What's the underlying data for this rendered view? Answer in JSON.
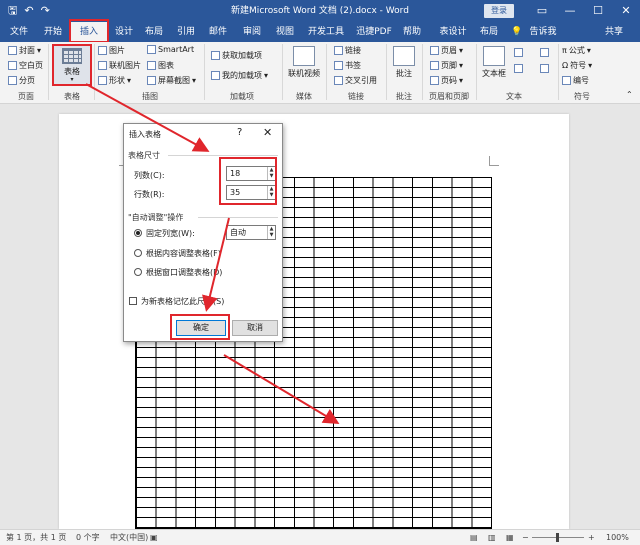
{
  "titlebar": {
    "title": "新建Microsoft Word 文档 (2).docx  -  Word",
    "login_label": "登录",
    "qat": {
      "save": "🖫",
      "undo": "↶",
      "redo": "↷"
    },
    "win": {
      "restore": "▭",
      "minimize": "—",
      "maximize": "☐",
      "close": "✕"
    }
  },
  "tabs": {
    "items": [
      {
        "label": "文件"
      },
      {
        "label": "开始"
      },
      {
        "label": "插入"
      },
      {
        "label": "设计"
      },
      {
        "label": "布局"
      },
      {
        "label": "引用"
      },
      {
        "label": "邮件"
      },
      {
        "label": "审阅"
      },
      {
        "label": "视图"
      },
      {
        "label": "开发工具"
      },
      {
        "label": "迅捷PDF"
      },
      {
        "label": "帮助"
      },
      {
        "label": "表设计"
      },
      {
        "label": "布局"
      }
    ],
    "tell_me": "告诉我",
    "share": "共享"
  },
  "ribbon": {
    "pages": {
      "cover": "封面",
      "blank": "空白页",
      "break": "分页",
      "group": "页面"
    },
    "table": {
      "label": "表格",
      "group": "表格"
    },
    "illustrations": {
      "picture": "图片",
      "online_picture": "联机图片",
      "shapes": "形状",
      "smartart": "SmartArt",
      "chart": "图表",
      "screenshot": "屏幕截图",
      "group": "插图"
    },
    "addins": {
      "get": "获取加载项",
      "my": "我的加载项",
      "group": "加载项"
    },
    "media": {
      "online_video": "联机视频",
      "group": "媒体"
    },
    "links": {
      "link": "链接",
      "bookmark": "书签",
      "cross_ref": "交叉引用",
      "group": "链接"
    },
    "comments": {
      "comment": "批注",
      "group": "批注"
    },
    "header_footer": {
      "header": "页眉",
      "footer": "页脚",
      "page_number": "页码",
      "group": "页眉和页脚"
    },
    "text": {
      "textbox": "文本框",
      "group": "文本"
    },
    "symbols": {
      "equation": "公式",
      "symbol": "符号",
      "numbering": "编号",
      "group": "符号"
    }
  },
  "dialog": {
    "title": "插入表格",
    "help": "?",
    "close": "✕",
    "size_section": "表格尺寸",
    "cols_label": "列数(C):",
    "cols_value": "18",
    "rows_label": "行数(R):",
    "rows_value": "35",
    "autofit_section": "\"自动调整\"操作",
    "fixed_label": "固定列宽(W):",
    "fixed_value": "自动",
    "by_content": "根据内容调整表格(F)",
    "by_window": "根据窗口调整表格(D)",
    "remember": "为新表格记忆此尺寸(S)",
    "ok": "确定",
    "cancel": "取消"
  },
  "statusbar": {
    "page": "第 1 页，共 1 页",
    "words": "0 个字",
    "lang": "中文(中国)",
    "zoom": "100%",
    "zoom_minus": "−",
    "zoom_plus": "+"
  },
  "colors": {
    "accent": "#2b579a",
    "highlight": "#e0262c"
  },
  "table": {
    "columns": 18,
    "rows": 35
  }
}
